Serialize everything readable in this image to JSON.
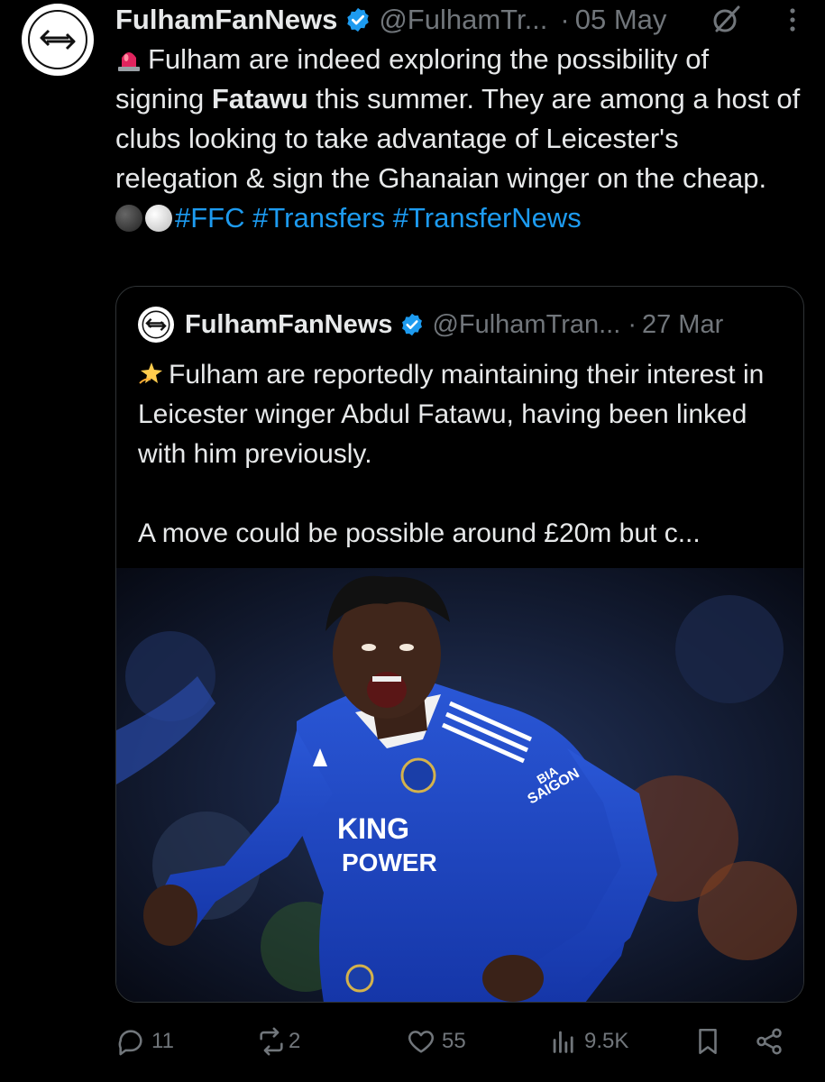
{
  "tweet": {
    "author_name": "FulhamFanNews",
    "handle": "@FulhamTr...",
    "separator": "·",
    "date": "05 May",
    "text_line1_pre": "Fulham are indeed exploring the possibility of signing ",
    "text_bold": "Fatawu",
    "text_line1_post": " this summer. They are among a host of clubs looking to take advantage of Leicester's relegation & sign the Ghanaian winger on the cheap.",
    "hashtags": [
      "#FFC",
      "#Transfers",
      "#TransferNews"
    ]
  },
  "quote": {
    "author_name": "FulhamFanNews",
    "handle": "@FulhamTran...",
    "separator": "·",
    "date": "27 Mar",
    "text_para1": "Fulham are reportedly maintaining their interest in Leicester winger Abdul Fatawu, having been linked with him previously.",
    "text_para2": "A move could be possible around £20m but c...",
    "image": {
      "shirt_sponsor_line1": "KING",
      "shirt_sponsor_line2": "POWER",
      "sleeve_sponsor_line1": "BIA",
      "sleeve_sponsor_line2": "SAIGON"
    }
  },
  "actions": {
    "replies": "11",
    "reposts": "2",
    "likes": "55",
    "views": "9.5K"
  },
  "icons": {
    "verified": "verified-badge-icon",
    "grok": "grok-icon",
    "more": "more-icon",
    "reply": "reply-icon",
    "repost": "repost-icon",
    "like": "heart-icon",
    "views": "views-icon",
    "bookmark": "bookmark-icon",
    "share": "share-icon"
  },
  "colors": {
    "background": "#000000",
    "text": "#e7e9ea",
    "secondary": "#71767b",
    "accent": "#1d9bf0",
    "border": "#2f3336"
  }
}
